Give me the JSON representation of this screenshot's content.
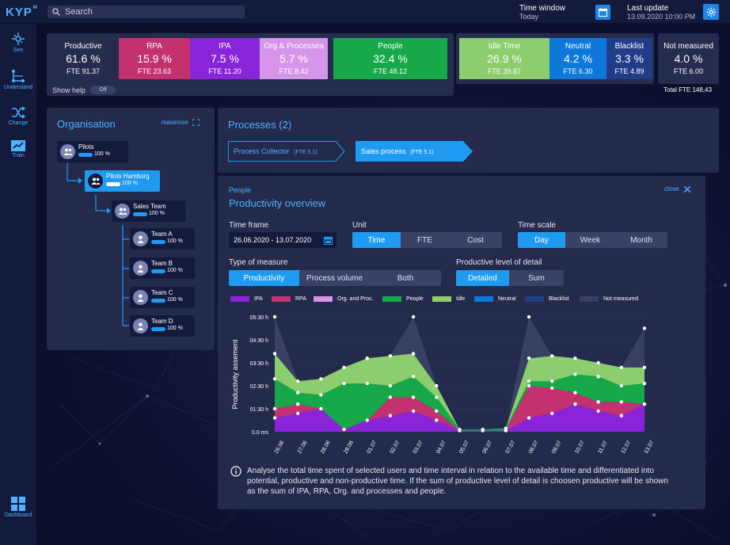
{
  "app": {
    "logo": "KYP",
    "logo_sup": "M"
  },
  "search": {
    "placeholder": "Search"
  },
  "time_window": {
    "label": "Time window",
    "value": "Today"
  },
  "last_update": {
    "label": "Last update",
    "value": "13.09.2020 10:00 PM"
  },
  "sidebar": {
    "items": [
      {
        "label": "See",
        "icon": "compass-icon"
      },
      {
        "label": "Understand",
        "icon": "network-icon"
      },
      {
        "label": "Change",
        "icon": "shuffle-icon"
      },
      {
        "label": "Train",
        "icon": "chart-up-icon"
      },
      {
        "label": "Dashboard",
        "icon": "grid-icon"
      }
    ]
  },
  "kpis": [
    {
      "label": "Productive",
      "value": "61.6 %",
      "fte": "FTE 91.37",
      "color": "#262c4e"
    },
    {
      "label": "RPA",
      "value": "15.9 %",
      "fte": "FTE 23.63",
      "color": "#c3326f"
    },
    {
      "label": "IPA",
      "value": "7.5 %",
      "fte": "FTE 11.20",
      "color": "#8a24d9"
    },
    {
      "label": "Org & Processes",
      "value": "5.7 %",
      "fte": "FTE 8.42",
      "color": "#d695e8"
    },
    {
      "label": "People",
      "value": "32.4 %",
      "fte": "FTE 48.12",
      "color": "#17a84a"
    },
    {
      "label": "Idle Time",
      "value": "26.9 %",
      "fte": "FTE 39.87",
      "color": "#8ccd6d"
    },
    {
      "label": "Neutral",
      "value": "4.2 %",
      "fte": "FTE 6.30",
      "color": "#0d78d9"
    },
    {
      "label": "Blacklist",
      "value": "3.3 %",
      "fte": "FTE 4.89",
      "color": "#213d88"
    },
    {
      "label": "Not measured",
      "value": "4.0 %",
      "fte": "FTE 6.00",
      "color": "#3a3f5e"
    }
  ],
  "show_help": {
    "label": "Show help",
    "toggle": "Off"
  },
  "total_fte": "Total FTE 148,43",
  "organisation": {
    "title": "Organisation",
    "maximise": "maximise",
    "nodes": [
      {
        "name": "Pilots",
        "percent": "100 %",
        "type": "group"
      },
      {
        "name": "Pilots Hamburg",
        "percent": "100 %",
        "type": "group",
        "selected": true
      },
      {
        "name": "Sales Team",
        "percent": "100 %",
        "type": "group"
      },
      {
        "name": "Team A",
        "percent": "100 %",
        "type": "person"
      },
      {
        "name": "Team B",
        "percent": "100 %",
        "type": "person"
      },
      {
        "name": "Team C",
        "percent": "100 %",
        "type": "person"
      },
      {
        "name": "Team D",
        "percent": "100 %",
        "type": "person"
      }
    ]
  },
  "processes": {
    "title": "Processes (2)",
    "items": [
      {
        "name": "Process Collector",
        "fte": "(FTE 5.1)",
        "active": false
      },
      {
        "name": "Sales process",
        "fte": "(FTE 5.1)",
        "active": true
      }
    ]
  },
  "productivity": {
    "subtitle": "People",
    "title": "Productivity overview",
    "close": "close",
    "time_frame": {
      "label": "Time frame",
      "value": "26.06.2020 - 13.07.2020"
    },
    "unit": {
      "label": "Unit",
      "options": [
        "Time",
        "FTE",
        "Cost"
      ],
      "selected": "Time"
    },
    "time_scale": {
      "label": "Time scale",
      "options": [
        "Day",
        "Week",
        "Month"
      ],
      "selected": "Day"
    },
    "type_of_measure": {
      "label": "Type of measure",
      "options": [
        "Productivity",
        "Process volume",
        "Both"
      ],
      "selected": "Productivity"
    },
    "detail": {
      "label": "Productive level of detail",
      "options": [
        "Detailed",
        "Sum"
      ],
      "selected": "Detailed"
    },
    "info": "Analyse the total time spent of selected users and time interval in relation to the available time and differentiated into potential, productive and non-productive time. If the sum of productive level of detail is choosen productive will be shown as the sum of IPA, RPA, Org. and processes and people."
  },
  "chart_data": {
    "type": "area",
    "ylabel": "Productivity assement",
    "y_ticks": [
      "0.0 ms",
      "01:30 h",
      "02:30 h",
      "03:30 h",
      "04:30 h",
      "05:30 h"
    ],
    "ylim": [
      0,
      5
    ],
    "x": [
      "26.06",
      "27.06",
      "28.06",
      "29.06",
      "01.07",
      "02.07",
      "03.07",
      "04.07",
      "05.07",
      "06.07",
      "07.07",
      "08.07",
      "09.07",
      "10.07",
      "11.07",
      "12.07",
      "13.07"
    ],
    "grid": true,
    "legend": "top",
    "series": [
      {
        "name": "IPA",
        "color": "#8a24d9",
        "values": [
          0.6,
          0.8,
          1.0,
          0.1,
          0.5,
          0.7,
          0.9,
          0.5,
          0.05,
          0.05,
          0.05,
          0.6,
          0.8,
          1.2,
          0.9,
          0.7,
          1.2
        ]
      },
      {
        "name": "RPA",
        "color": "#c3326f",
        "values": [
          0.4,
          0.4,
          0.0,
          0.0,
          0.0,
          0.8,
          0.6,
          0.4,
          0.0,
          0.0,
          0.0,
          1.4,
          1.1,
          0.5,
          0.4,
          0.6,
          0.0
        ]
      },
      {
        "name": "Org. and Proc.",
        "color": "#d695e8",
        "values": [
          0.0,
          0.0,
          0.0,
          0.0,
          0.0,
          0.0,
          0.0,
          0.0,
          0.0,
          0.0,
          0.0,
          0.0,
          0.0,
          0.0,
          0.0,
          0.0,
          0.0
        ]
      },
      {
        "name": "People",
        "color": "#17a84a",
        "values": [
          1.3,
          0.5,
          0.6,
          2.0,
          1.6,
          0.5,
          0.9,
          0.6,
          0.05,
          0.05,
          0.1,
          0.2,
          0.3,
          0.8,
          1.1,
          0.7,
          0.9
        ]
      },
      {
        "name": "Idle",
        "color": "#8ccd6d",
        "values": [
          1.1,
          0.5,
          0.7,
          0.7,
          1.1,
          1.3,
          1.0,
          0.5,
          0.0,
          0.0,
          0.0,
          1.0,
          1.1,
          0.7,
          0.6,
          0.8,
          0.7
        ]
      },
      {
        "name": "Neutral",
        "color": "#0d78d9",
        "values": [
          0.0,
          0.0,
          0.0,
          0.0,
          0.0,
          0.0,
          0.0,
          0.0,
          0.0,
          0.0,
          0.0,
          0.0,
          0.0,
          0.0,
          0.0,
          0.0,
          0.0
        ]
      },
      {
        "name": "Blacklist",
        "color": "#213d88",
        "values": [
          0.0,
          0.0,
          0.0,
          0.0,
          0.0,
          0.0,
          0.0,
          0.0,
          0.0,
          0.0,
          0.0,
          0.0,
          0.0,
          0.0,
          0.0,
          0.0,
          0.0
        ]
      },
      {
        "name": "Not measured",
        "color": "#3a4064",
        "values": [
          1.6,
          0.0,
          0.0,
          0.0,
          0.0,
          0.0,
          1.6,
          0.0,
          0.0,
          0.0,
          0.0,
          1.8,
          0.0,
          0.0,
          0.0,
          0.0,
          1.7
        ]
      }
    ]
  }
}
